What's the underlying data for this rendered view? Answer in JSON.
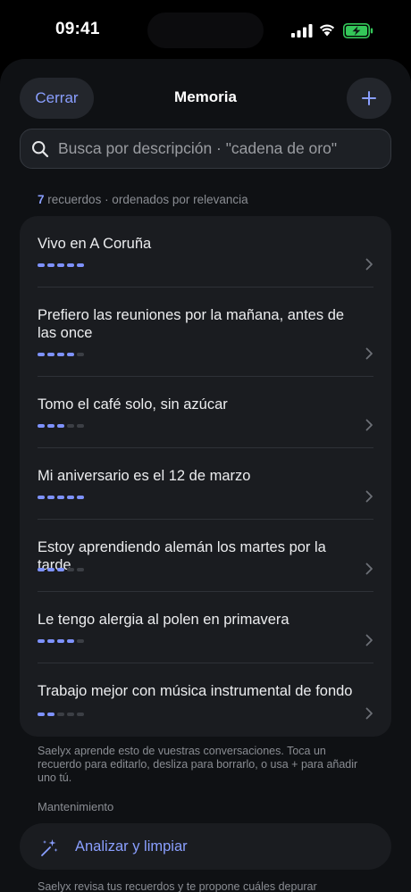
{
  "status_bar": {
    "time": "09:41"
  },
  "header": {
    "close_label": "Cerrar",
    "title": "Memoria",
    "add_icon": "plus-icon"
  },
  "search": {
    "placeholder": "Busca por descripción · \"cadena de oro\""
  },
  "summary": {
    "count": "7",
    "text": "recuerdos · ordenados por relevancia"
  },
  "memories": [
    {
      "text": "Vivo en A Coruña",
      "relevance": 5
    },
    {
      "text": "Prefiero las reuniones por la mañana, antes de las once",
      "relevance": 4
    },
    {
      "text": "Tomo el café solo, sin azúcar",
      "relevance": 3
    },
    {
      "text": "Mi aniversario es el 12 de marzo",
      "relevance": 5
    },
    {
      "text": "Estoy aprendiendo alemán los martes por la tarde",
      "relevance": 3
    },
    {
      "text": "Le tengo alergia al polen en primavera",
      "relevance": 4
    },
    {
      "text": "Trabajo mejor con música instrumental de fondo",
      "relevance": 2
    }
  ],
  "relevance_max": 5,
  "footnote": "Saelyx aprende esto de vuestras conversaciones. Toca un recuerdo para editarlo, desliza para borrarlo, o usa + para añadir uno tú.",
  "maintenance": {
    "header": "Mantenimiento",
    "action_label": "Analizar y limpiar",
    "action_icon": "sparkles-icon",
    "description": "Saelyx revisa tus recuerdos y te propone cuáles depurar"
  },
  "colors": {
    "accent": "#8a9fff",
    "relevance_on": "#7e92ff",
    "relevance_off": "#3c3f45",
    "battery": "#34c759"
  }
}
